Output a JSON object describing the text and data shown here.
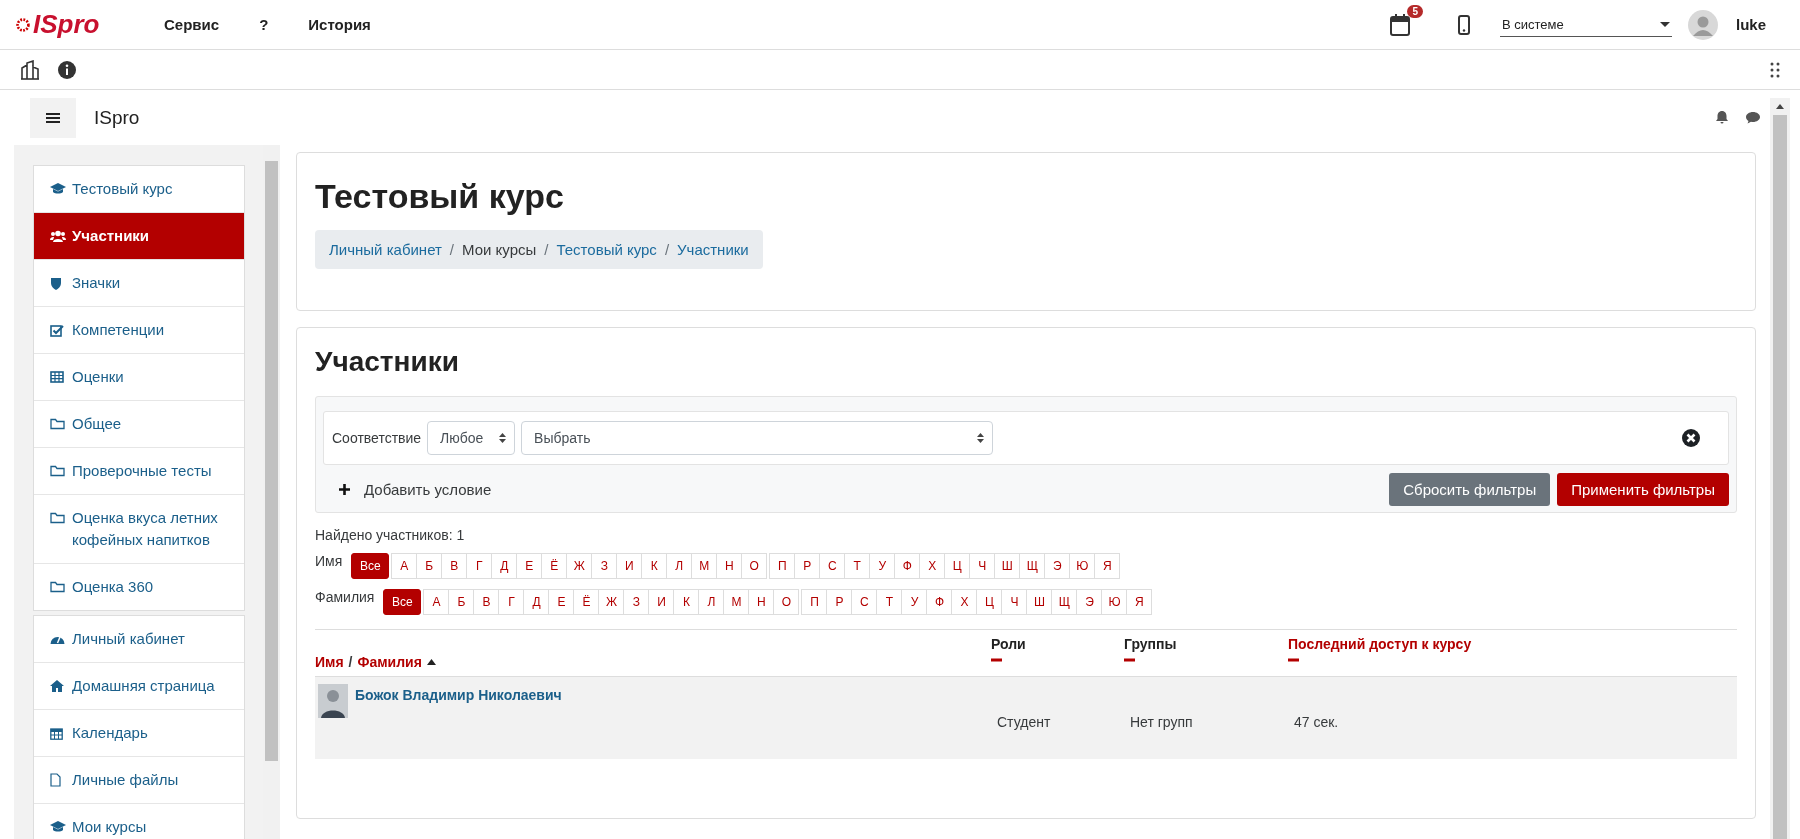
{
  "topbar": {
    "logo": "ISpro",
    "menu": [
      "Сервис",
      "?",
      "История"
    ],
    "calendar_badge": "5",
    "status_select": "В системе",
    "user": "luke"
  },
  "header": {
    "site_name": "ISpro"
  },
  "sidebar": {
    "groups": [
      [
        {
          "label": "Тестовый курс",
          "kind": "cap",
          "selected": false
        },
        {
          "label": "Участники",
          "kind": "users",
          "selected": true
        },
        {
          "label": "Значки",
          "kind": "shield",
          "selected": false
        },
        {
          "label": "Компетенции",
          "kind": "check",
          "selected": false
        },
        {
          "label": "Оценки",
          "kind": "table",
          "selected": false
        },
        {
          "label": "Общее",
          "kind": "folder",
          "selected": false
        },
        {
          "label": "Проверочные тесты",
          "kind": "folder",
          "selected": false
        },
        {
          "label": "Оценка вкуса летних кофейных напитков",
          "kind": "folder",
          "selected": false
        },
        {
          "label": "Оценка 360",
          "kind": "folder",
          "selected": false
        }
      ],
      [
        {
          "label": "Личный кабинет",
          "kind": "dashboard",
          "selected": false
        },
        {
          "label": "Домашняя страница",
          "kind": "home",
          "selected": false
        },
        {
          "label": "Календарь",
          "kind": "calendar",
          "selected": false
        },
        {
          "label": "Личные файлы",
          "kind": "file",
          "selected": false
        },
        {
          "label": "Мои курсы",
          "kind": "cap",
          "selected": false
        }
      ]
    ]
  },
  "course": {
    "title": "Тестовый курс",
    "separator": "/",
    "breadcrumb": [
      {
        "label": "Личный кабинет",
        "link": true
      },
      {
        "label": "Мои курсы",
        "link": false
      },
      {
        "label": "Тестовый курс",
        "link": true
      },
      {
        "label": "Участники",
        "link": true
      }
    ]
  },
  "participants": {
    "heading": "Участники",
    "filter": {
      "match_label": "Соответствие",
      "match_value": "Любое",
      "condition_value": "Выбрать",
      "add_condition": "Добавить условие",
      "buttons": [
        {
          "label": "Сбросить фильтры",
          "kind": "secondary"
        },
        {
          "label": "Применить фильтры",
          "kind": "primary"
        }
      ]
    },
    "count": "Найдено участников: 1",
    "initials": [
      {
        "label": "Имя",
        "all": {
          "label": "Все",
          "selected": true
        },
        "groups": [
          [
            {
              "label": "А",
              "selected": false
            },
            {
              "label": "Б",
              "selected": false
            },
            {
              "label": "В",
              "selected": false
            },
            {
              "label": "Г",
              "selected": false
            },
            {
              "label": "Д",
              "selected": false
            },
            {
              "label": "Е",
              "selected": false
            },
            {
              "label": "Ё",
              "selected": false
            },
            {
              "label": "Ж",
              "selected": false
            },
            {
              "label": "З",
              "selected": false
            },
            {
              "label": "И",
              "selected": false
            },
            {
              "label": "К",
              "selected": false
            },
            {
              "label": "Л",
              "selected": false
            },
            {
              "label": "М",
              "selected": false
            },
            {
              "label": "Н",
              "selected": false
            },
            {
              "label": "О",
              "selected": false
            }
          ],
          [
            {
              "label": "П",
              "selected": false
            },
            {
              "label": "Р",
              "selected": false
            },
            {
              "label": "С",
              "selected": false
            },
            {
              "label": "Т",
              "selected": false
            },
            {
              "label": "У",
              "selected": false
            },
            {
              "label": "Ф",
              "selected": false
            },
            {
              "label": "Х",
              "selected": false
            },
            {
              "label": "Ц",
              "selected": false
            },
            {
              "label": "Ч",
              "selected": false
            },
            {
              "label": "Ш",
              "selected": false
            },
            {
              "label": "Щ",
              "selected": false
            },
            {
              "label": "Э",
              "selected": false
            },
            {
              "label": "Ю",
              "selected": false
            },
            {
              "label": "Я",
              "selected": false
            }
          ]
        ]
      },
      {
        "label": "Фамилия",
        "all": {
          "label": "Все",
          "selected": true
        },
        "groups": [
          [
            {
              "label": "А",
              "selected": false
            },
            {
              "label": "Б",
              "selected": false
            },
            {
              "label": "В",
              "selected": false
            },
            {
              "label": "Г",
              "selected": false
            },
            {
              "label": "Д",
              "selected": false
            },
            {
              "label": "Е",
              "selected": false
            },
            {
              "label": "Ё",
              "selected": false
            },
            {
              "label": "Ж",
              "selected": false
            },
            {
              "label": "З",
              "selected": false
            },
            {
              "label": "И",
              "selected": false
            },
            {
              "label": "К",
              "selected": false
            },
            {
              "label": "Л",
              "selected": false
            },
            {
              "label": "М",
              "selected": false
            },
            {
              "label": "Н",
              "selected": false
            },
            {
              "label": "О",
              "selected": false
            }
          ],
          [
            {
              "label": "П",
              "selected": false
            },
            {
              "label": "Р",
              "selected": false
            },
            {
              "label": "С",
              "selected": false
            },
            {
              "label": "Т",
              "selected": false
            },
            {
              "label": "У",
              "selected": false
            },
            {
              "label": "Ф",
              "selected": false
            },
            {
              "label": "Х",
              "selected": false
            },
            {
              "label": "Ц",
              "selected": false
            },
            {
              "label": "Ч",
              "selected": false
            },
            {
              "label": "Ш",
              "selected": false
            },
            {
              "label": "Щ",
              "selected": false
            },
            {
              "label": "Э",
              "selected": false
            },
            {
              "label": "Ю",
              "selected": false
            },
            {
              "label": "Я",
              "selected": false
            }
          ]
        ]
      }
    ],
    "table": {
      "name_column": {
        "first": "Имя",
        "separator": "/",
        "last": "Фамилия"
      },
      "columns": [
        {
          "label": "Роли",
          "link": false
        },
        {
          "label": "Группы",
          "link": false
        },
        {
          "label": "Последний доступ к курсу",
          "link": true
        }
      ],
      "rows": [
        {
          "name": "Божок Владимир Николаевич",
          "roles": "Студент",
          "groups": "Нет групп",
          "last_access": "47 сек."
        }
      ]
    }
  }
}
